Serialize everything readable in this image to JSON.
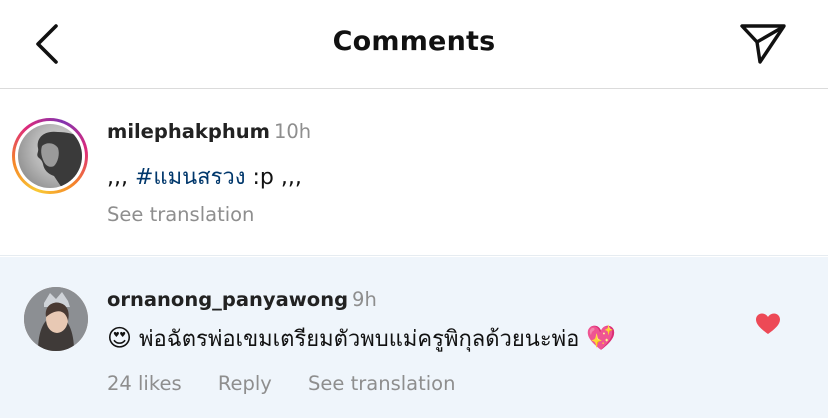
{
  "header": {
    "title": "Comments",
    "back_icon": "chevron-left-icon",
    "send_icon": "paper-plane-icon"
  },
  "caption": {
    "username": "milephakphum",
    "time": "10h",
    "text_prefix": ",,, ",
    "hashtag": "#แมนสรวง",
    "text_suffix": " :p ,,,",
    "see_translation": "See translation"
  },
  "reply": {
    "username": "ornanong_panyawong",
    "time": "9h",
    "emoji_start": "😍",
    "text": " พ่อฉัตรพ่อเขมเตรียมตัวพบแม่ครูพิกุลด้วยนะพ่อ ",
    "emoji_end": "💖",
    "likes": "24 likes",
    "reply_label": "Reply",
    "see_translation": "See translation",
    "heart_icon": "heart-filled-icon",
    "heart_color": "#ed4956"
  },
  "colors": {
    "hashtag": "#00376b",
    "secondary_text": "#8e8e8e",
    "reply_background": "#eff5fb"
  }
}
